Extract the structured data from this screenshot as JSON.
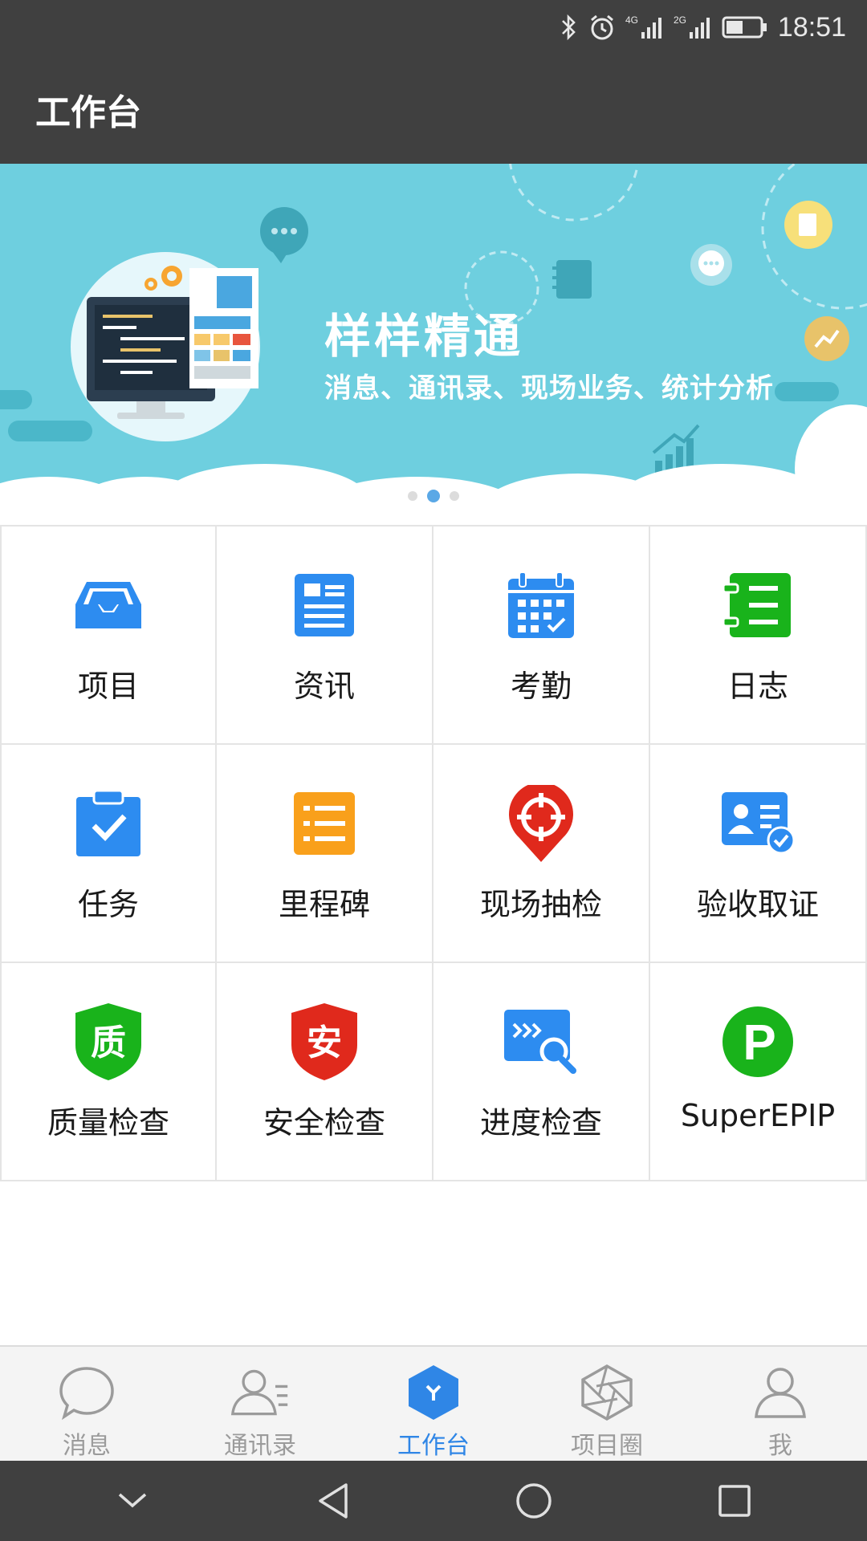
{
  "status_bar": {
    "time": "18:51",
    "network_1": "4G",
    "network_2": "2G",
    "icons": [
      "bluetooth-icon",
      "alarm-icon",
      "signal-icon",
      "battery-icon"
    ]
  },
  "app_bar": {
    "title": "工作台"
  },
  "banner": {
    "headline": "样样精通",
    "subline": "消息、通讯录、现场业务、统计分析",
    "page_count": 3,
    "active_page": 2
  },
  "grid": {
    "items": [
      {
        "label": "项目",
        "icon": "inbox-tray-icon",
        "color": "#2d8cf0"
      },
      {
        "label": "资讯",
        "icon": "news-icon",
        "color": "#2d8cf0"
      },
      {
        "label": "考勤",
        "icon": "calendar-check-icon",
        "color": "#2d8cf0"
      },
      {
        "label": "日志",
        "icon": "log-book-icon",
        "color": "#19b31b"
      },
      {
        "label": "任务",
        "icon": "clipboard-check-icon",
        "color": "#2d8cf0"
      },
      {
        "label": "里程碑",
        "icon": "list-icon",
        "color": "#f9a01b"
      },
      {
        "label": "现场抽检",
        "icon": "target-pin-icon",
        "color": "#e0291c"
      },
      {
        "label": "验收取证",
        "icon": "id-card-check-icon",
        "color": "#2d8cf0"
      },
      {
        "label": "质量检查",
        "icon": "quality-shield-icon",
        "color": "#19b31b",
        "glyph": "质"
      },
      {
        "label": "安全检查",
        "icon": "safety-shield-icon",
        "color": "#e0291c",
        "glyph": "安"
      },
      {
        "label": "进度检查",
        "icon": "progress-search-icon",
        "color": "#2d8cf0"
      },
      {
        "label": "SuperEPIP",
        "icon": "p-logo-icon",
        "color": "#19b31b",
        "glyph": "P"
      }
    ]
  },
  "tabbar": {
    "tabs": [
      {
        "label": "消息",
        "icon": "chat-bubble-icon"
      },
      {
        "label": "通讯录",
        "icon": "contacts-icon"
      },
      {
        "label": "工作台",
        "icon": "workbench-hex-icon",
        "active": true
      },
      {
        "label": "项目圈",
        "icon": "aperture-icon"
      },
      {
        "label": "我",
        "icon": "person-icon"
      }
    ],
    "active_color": "#2f86e6",
    "inactive_color": "#9b9b9b"
  },
  "nav_bar": {
    "buttons": [
      "collapse-icon",
      "back-icon",
      "home-icon",
      "recents-icon"
    ]
  }
}
